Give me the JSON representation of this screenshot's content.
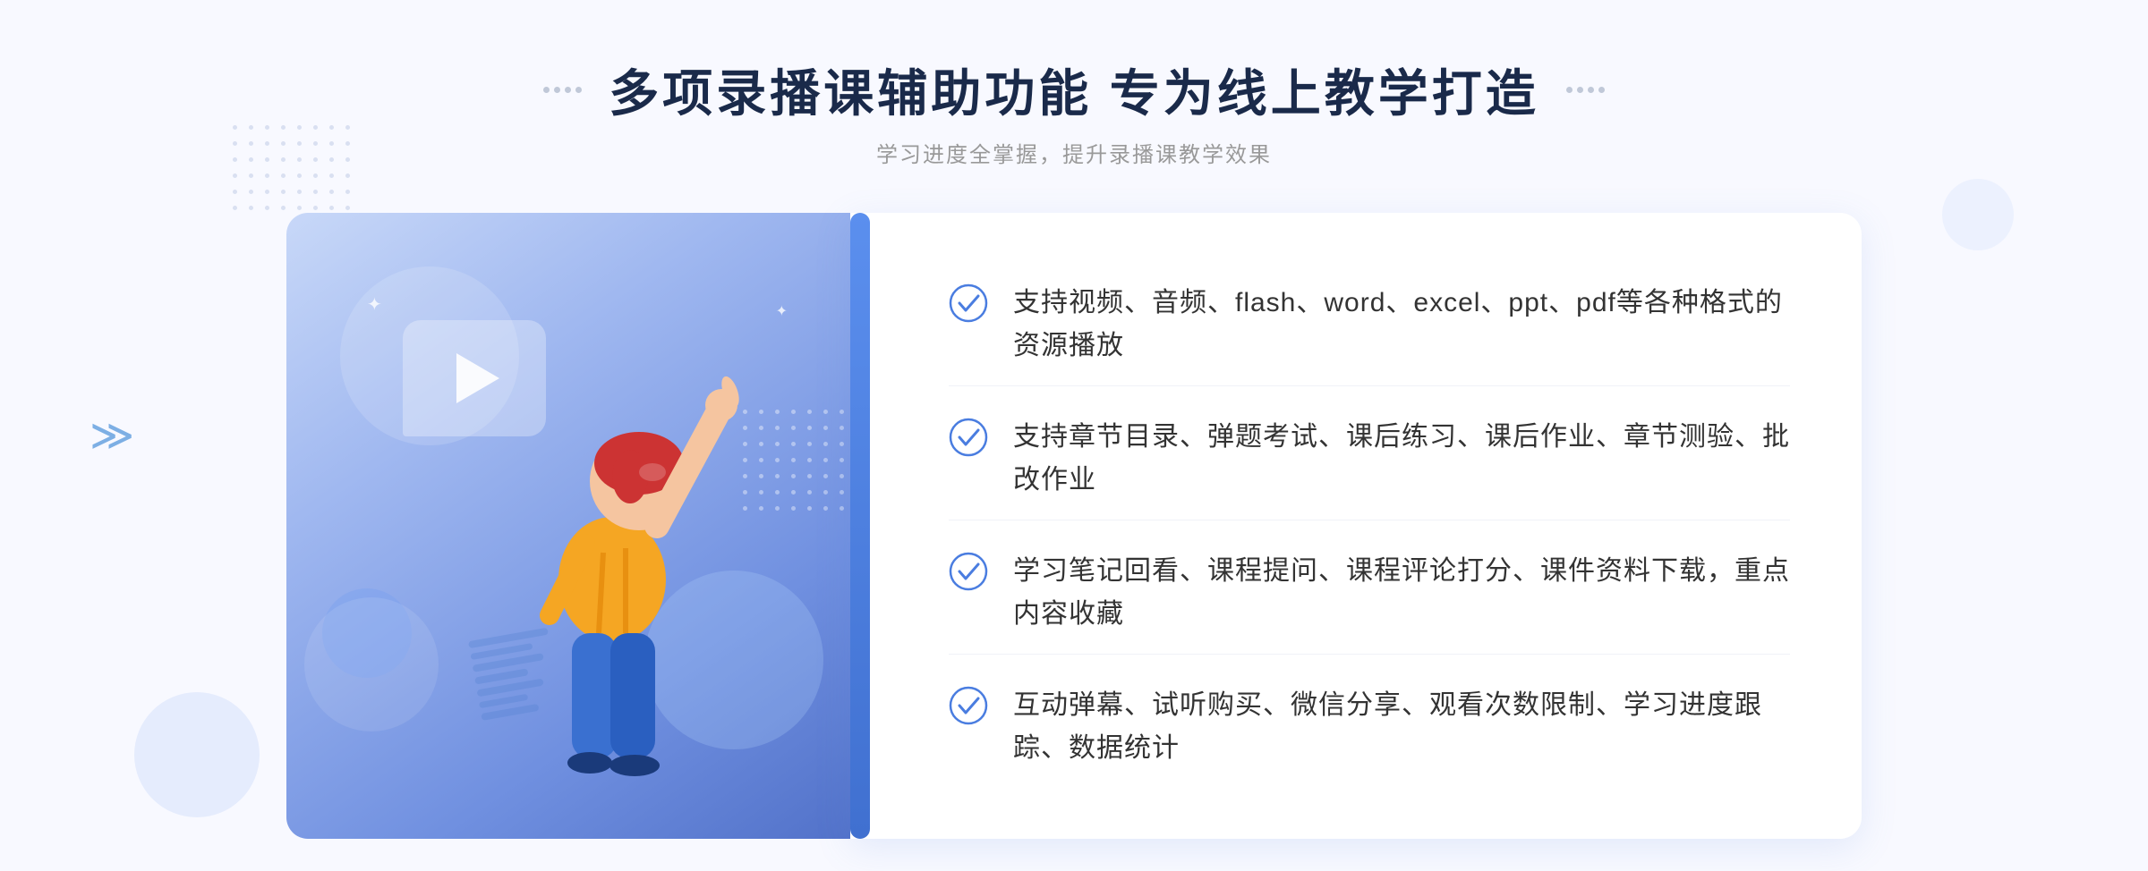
{
  "header": {
    "title": "多项录播课辅助功能 专为线上教学打造",
    "subtitle": "学习进度全掌握，提升录播课教学效果"
  },
  "features": [
    {
      "id": "feature-1",
      "text": "支持视频、音频、flash、word、excel、ppt、pdf等各种格式的资源播放"
    },
    {
      "id": "feature-2",
      "text": "支持章节目录、弹题考试、课后练习、课后作业、章节测验、批改作业"
    },
    {
      "id": "feature-3",
      "text": "学习笔记回看、课程提问、课程评论打分、课件资料下载，重点内容收藏"
    },
    {
      "id": "feature-4",
      "text": "互动弹幕、试听购买、微信分享、观看次数限制、学习进度跟踪、数据统计"
    }
  ],
  "colors": {
    "primary": "#4a7de0",
    "primary_dark": "#3060c0",
    "title": "#1a2a4a",
    "text": "#333333",
    "subtitle": "#999999",
    "check": "#4a7de0"
  }
}
